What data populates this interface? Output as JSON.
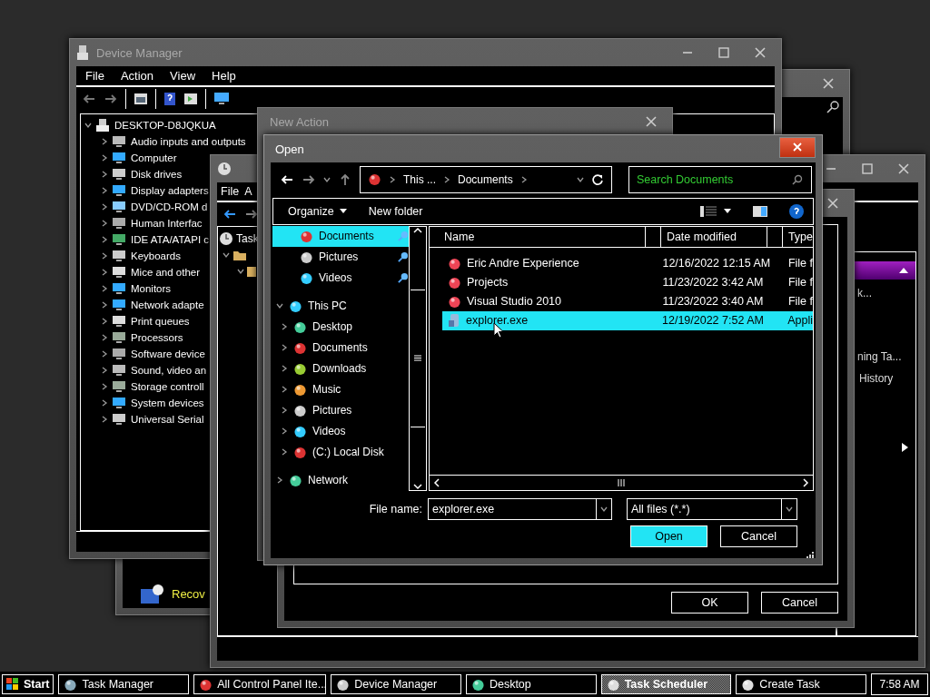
{
  "device_manager": {
    "title": "Device Manager",
    "menu": [
      "File",
      "Action",
      "View",
      "Help"
    ],
    "tree": {
      "label": "DESKTOP-D8JQKUA",
      "expanded": true,
      "children": [
        {
          "label": "Audio inputs and outputs",
          "expanded": false
        },
        {
          "label": "Computer",
          "expanded": false
        },
        {
          "label": "Disk drives",
          "expanded": false
        },
        {
          "label": "Display adapters",
          "expanded": false
        },
        {
          "label": "DVD/CD-ROM d",
          "expanded": false
        },
        {
          "label": "Human Interfac",
          "expanded": false
        },
        {
          "label": "IDE ATA/ATAPI c",
          "expanded": false
        },
        {
          "label": "Keyboards",
          "expanded": false
        },
        {
          "label": "Mice and other",
          "expanded": false
        },
        {
          "label": "Monitors",
          "expanded": false
        },
        {
          "label": "Network adapte",
          "expanded": false
        },
        {
          "label": "Print queues",
          "expanded": false
        },
        {
          "label": "Processors",
          "expanded": false
        },
        {
          "label": "Software device",
          "expanded": false
        },
        {
          "label": "Sound, video an",
          "expanded": false
        },
        {
          "label": "Storage controll",
          "expanded": false
        },
        {
          "label": "System devices",
          "expanded": false
        },
        {
          "label": "Universal Serial",
          "expanded": false
        }
      ]
    }
  },
  "control_panel": {
    "items": [
      "Recov"
    ]
  },
  "task_scheduler": {
    "menu": [
      "File",
      "A"
    ],
    "tree": [
      {
        "label": "Task"
      }
    ],
    "actions": [
      "k...",
      "ning Ta...",
      "History"
    ]
  },
  "create_task": {
    "buttons": [
      "OK",
      "Cancel"
    ]
  },
  "new_action": {
    "title": "New Action"
  },
  "open_dialog": {
    "title": "Open",
    "breadcrumb": [
      "This ...",
      "Documents"
    ],
    "search": {
      "placeholder": "Search Documents"
    },
    "toolbar": [
      "Organize",
      "New folder"
    ],
    "nav_pane": [
      {
        "label": "Documents",
        "selected": true,
        "pinned": true
      },
      {
        "label": "Pictures",
        "selected": false,
        "pinned": true
      },
      {
        "label": "Videos",
        "selected": false,
        "pinned": true
      },
      {
        "label": "This PC",
        "selected": false,
        "expanded": true,
        "children": [
          {
            "label": "Desktop",
            "selected": false,
            "expanded": false
          },
          {
            "label": "Documents",
            "selected": false,
            "expanded": false
          },
          {
            "label": "Downloads",
            "selected": false,
            "expanded": false
          },
          {
            "label": "Music",
            "selected": false,
            "expanded": false
          },
          {
            "label": "Pictures",
            "selected": false,
            "expanded": false
          },
          {
            "label": "Videos",
            "selected": false,
            "expanded": false
          },
          {
            "label": "(C:) Local Disk",
            "selected": false,
            "expanded": false
          }
        ]
      },
      {
        "label": "Network",
        "selected": false,
        "expanded": false
      }
    ],
    "columns": [
      "Name",
      "Date modified",
      "Type"
    ],
    "files": [
      {
        "kind": "folder",
        "name": "Eric Andre Experience",
        "date": "12/16/2022 12:15 AM",
        "type": "File f",
        "selected": false
      },
      {
        "kind": "folder",
        "name": "Projects",
        "date": "11/23/2022 3:42 AM",
        "type": "File f",
        "selected": false
      },
      {
        "kind": "folder",
        "name": "Visual Studio 2010",
        "date": "11/23/2022 3:40 AM",
        "type": "File f",
        "selected": false
      },
      {
        "kind": "app",
        "name": "explorer.exe",
        "date": "12/19/2022 7:52 AM",
        "type": "Appli",
        "selected": true
      }
    ],
    "file_name_label": "File name:",
    "file_name": "explorer.exe",
    "filter": "All files (*.*)",
    "buttons": [
      "Open",
      "Cancel"
    ]
  },
  "taskbar": {
    "start": "Start",
    "items": [
      {
        "label": "Task Manager",
        "selected": false
      },
      {
        "label": "All Control Panel Ite...",
        "selected": false
      },
      {
        "label": "Device Manager",
        "selected": false
      },
      {
        "label": "Desktop",
        "selected": false
      },
      {
        "label": "Task Scheduler",
        "selected": true
      },
      {
        "label": "Create Task",
        "selected": false
      }
    ],
    "clock": "7:58 AM"
  }
}
